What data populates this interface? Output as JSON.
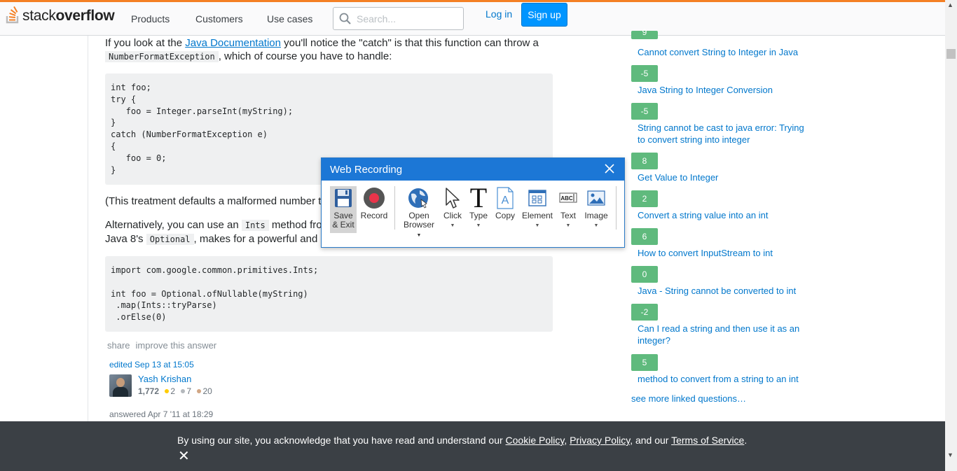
{
  "header": {
    "logo_light": "stack",
    "logo_bold": "overflow",
    "nav": [
      "Products",
      "Customers",
      "Use cases"
    ],
    "search_placeholder": "Search...",
    "login": "Log in",
    "signup": "Sign up",
    "accent": "#f48024"
  },
  "answer": {
    "para1_pre": "If you look at the ",
    "para1_link": "Java Documentation",
    "para1_post": " you'll notice the \"catch\" is that this function can throw a",
    "para1_code": "NumberFormatException",
    "para1_end": ", which of course you have to handle:",
    "code1": "int foo;\ntry {\n   foo = Integer.parseInt(myString);\n}\ncatch (NumberFormatException e)\n{\n   foo = 0;\n}",
    "para2": "(This treatment defaults a malformed number t",
    "para3_pre": "Alternatively, you can use an ",
    "para3_code": "Ints",
    "para3_post": " method fro",
    "para4_pre": "Java 8's ",
    "para4_code": "Optional",
    "para4_post": ", makes for a powerful and c",
    "code2": "import com.google.common.primitives.Ints;\n\nint foo = Optional.ofNullable(myString)\n .map(Ints::tryParse)\n .orElse(0)",
    "share": "share",
    "improve": "improve this answer",
    "edited": "edited Sep 13 at 15:05",
    "editor_name": "Yash Krishan",
    "editor_rep": "1,772",
    "gold": "2",
    "silver": "7",
    "bronze": "20",
    "answered": "answered Apr 7 '11 at 18:29"
  },
  "linked": [
    {
      "score": "9",
      "title": "Cannot convert String to Integer in Java"
    },
    {
      "score": "-5",
      "title": "Java String to Integer Conversion"
    },
    {
      "score": "-5",
      "title": "String cannot be cast to java error: Trying to convert string into integer"
    },
    {
      "score": "8",
      "title": "Get Value to Integer"
    },
    {
      "score": "2",
      "title": "Convert a string value into an int"
    },
    {
      "score": "6",
      "title": "How to convert InputStream to int"
    },
    {
      "score": "0",
      "title": "Java - String cannot be converted to int"
    },
    {
      "score": "-2",
      "title": "Can I read a string and then use it as an integer?"
    },
    {
      "score": "5",
      "title": "method to convert from a string to an int"
    }
  ],
  "see_more": "see more linked questions…",
  "cookie": {
    "pre": "By using our site, you acknowledge that you have read and understand our ",
    "cookie_policy": "Cookie Policy",
    "sep1": ", ",
    "privacy_policy": "Privacy Policy",
    "sep2": ", and our ",
    "terms": "Terms of Service",
    "end": ".",
    "close": "✕"
  },
  "dialog": {
    "title": "Web Recording",
    "tools": {
      "save_exit_1": "Save",
      "save_exit_2": "& Exit",
      "record": "Record",
      "open_browser_1": "Open",
      "open_browser_2": "Browser",
      "click": "Click",
      "type": "Type",
      "copy": "Copy",
      "element": "Element",
      "text": "Text",
      "image": "Image"
    },
    "colors": {
      "title_bar": "#1c77d6",
      "record_dot": "#e8344a"
    }
  }
}
